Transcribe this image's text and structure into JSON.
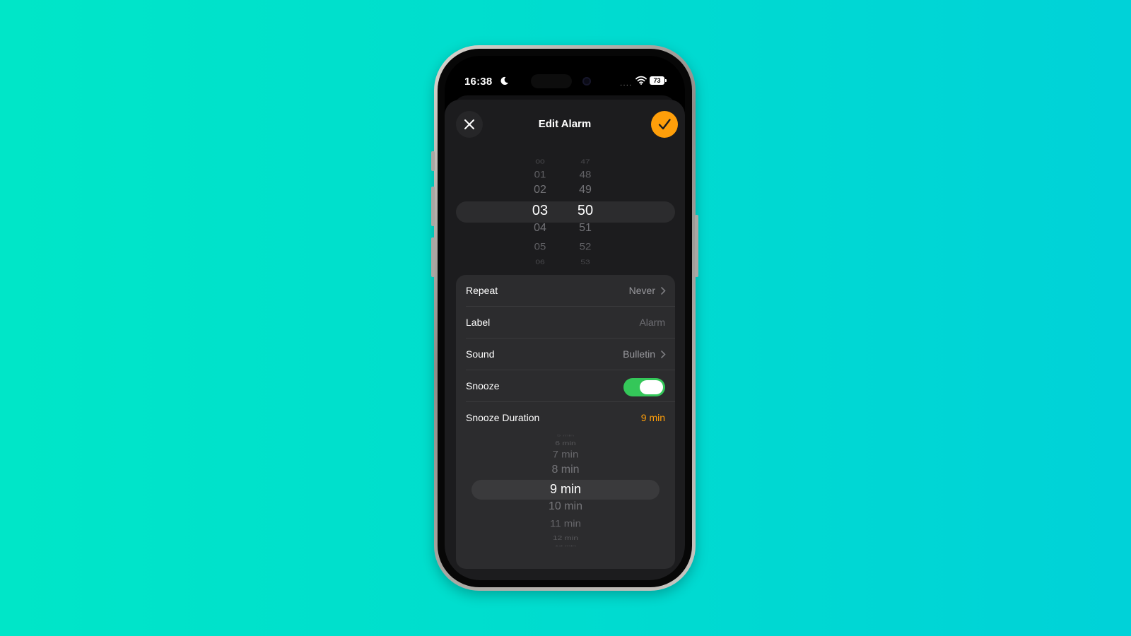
{
  "status": {
    "time": "16:38",
    "battery": "73"
  },
  "header": {
    "title": "Edit Alarm"
  },
  "time_picker": {
    "hours": [
      "00",
      "01",
      "02",
      "03",
      "04",
      "05",
      "06"
    ],
    "minutes": [
      "47",
      "48",
      "49",
      "50",
      "51",
      "52",
      "53"
    ],
    "selected_hour": "03",
    "selected_minute": "50"
  },
  "settings": {
    "repeat": {
      "label": "Repeat",
      "value": "Never"
    },
    "alarm_label": {
      "label": "Label",
      "placeholder": "Alarm"
    },
    "sound": {
      "label": "Sound",
      "value": "Bulletin"
    },
    "snooze": {
      "label": "Snooze",
      "on": true
    },
    "snooze_duration": {
      "label": "Snooze Duration",
      "value": "9 min"
    }
  },
  "snooze_picker": {
    "options": [
      "5 min",
      "6 min",
      "7 min",
      "8 min",
      "9 min",
      "10 min",
      "11 min",
      "12 min",
      "13 min"
    ],
    "selected": "9 min"
  },
  "colors": {
    "accent": "#ff9f0a",
    "toggle_on": "#34c759",
    "background": "#00dccf"
  }
}
